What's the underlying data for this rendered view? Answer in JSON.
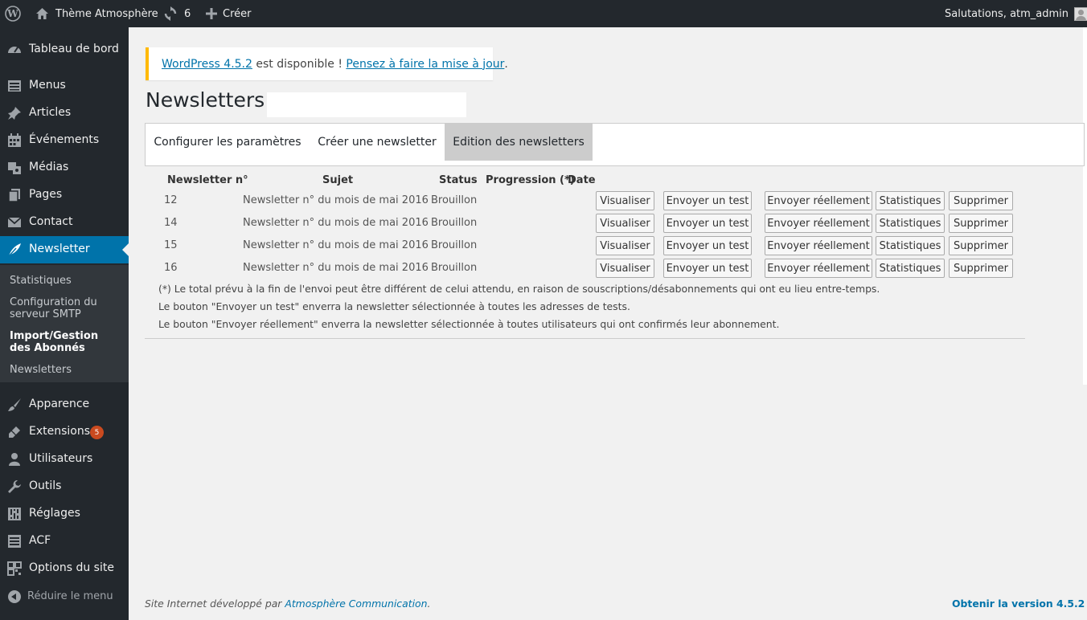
{
  "admin_bar": {
    "site_name": "Thème Atmosphère",
    "updates_count": "6",
    "new_label": "Créer",
    "greeting": "Salutations, atm_admin"
  },
  "sidebar": {
    "items": [
      {
        "label": "Tableau de bord",
        "icon": "dashboard-icon"
      },
      {
        "label": "Menus",
        "icon": "menus-icon"
      },
      {
        "label": "Articles",
        "icon": "pin-icon"
      },
      {
        "label": "Événements",
        "icon": "calendar-icon"
      },
      {
        "label": "Médias",
        "icon": "media-icon"
      },
      {
        "label": "Pages",
        "icon": "pages-icon"
      },
      {
        "label": "Contact",
        "icon": "mail-icon"
      },
      {
        "label": "Newsletter",
        "icon": "feather-icon"
      },
      {
        "label": "Apparence",
        "icon": "brush-icon"
      },
      {
        "label": "Extensions",
        "icon": "plug-icon",
        "badge": "5"
      },
      {
        "label": "Utilisateurs",
        "icon": "user-icon"
      },
      {
        "label": "Outils",
        "icon": "wrench-icon"
      },
      {
        "label": "Réglages",
        "icon": "settings-icon"
      },
      {
        "label": "ACF",
        "icon": "list-icon"
      },
      {
        "label": "Options du site",
        "icon": "grid-icon"
      }
    ],
    "submenu": [
      "Statistiques",
      "Configuration du serveur SMTP",
      "Import/Gestion des Abonnés",
      "Newsletters"
    ],
    "collapse_label": "Réduire le menu"
  },
  "notice": {
    "version_link": "WordPress 4.5.2",
    "middle_text": " est disponible ! ",
    "update_link": "Pensez à faire la mise à jour",
    "end_text": "."
  },
  "page": {
    "title": "Newsletters"
  },
  "tabs": [
    "Configurer les paramètres",
    "Créer une newsletter",
    "Edition des newsletters"
  ],
  "table": {
    "headers": [
      "Newsletter n°",
      "Sujet",
      "Status",
      "Progression (*)",
      "Date"
    ],
    "rows": [
      {
        "number": "12",
        "subject": "Newsletter n° du mois de mai 2016",
        "status": "Brouillon"
      },
      {
        "number": "14",
        "subject": "Newsletter n° du mois de mai 2016",
        "status": "Brouillon"
      },
      {
        "number": "15",
        "subject": "Newsletter n° du mois de mai 2016",
        "status": "Brouillon"
      },
      {
        "number": "16",
        "subject": "Newsletter n° du mois de mai 2016",
        "status": "Brouillon"
      }
    ],
    "actions": [
      "Visualiser",
      "Envoyer un test",
      "Envoyer réellement",
      "Statistiques",
      "Supprimer"
    ]
  },
  "notes": [
    "(*) Le total prévu à la fin de l'envoi peut être différent de celui attendu, en raison de souscriptions/désabonnements qui ont eu lieu entre-temps.",
    "Le bouton \"Envoyer un test\" enverra la newsletter sélectionnée à toutes les adresses de tests.",
    "Le bouton \"Envoyer réellement\" enverra la newsletter sélectionnée à toutes utilisateurs qui ont confirmés leur abonnement."
  ],
  "footer": {
    "credit_prefix": "Site Internet développé par ",
    "credit_link": "Atmosphère Communication",
    "credit_suffix": ".",
    "version_link": "Obtenir la version 4.5.2"
  },
  "colors": {
    "admin_bar": "#23282d",
    "sidebar_active": "#0073aa",
    "notice_border": "#ffb900",
    "badge": "#ca4a1f"
  }
}
